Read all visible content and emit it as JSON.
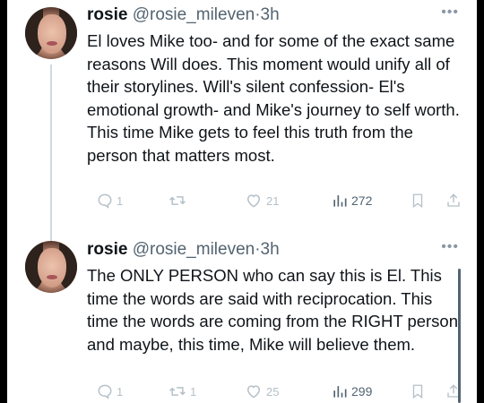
{
  "tweets": [
    {
      "name": "rosie",
      "handle": "@rosie_mileven",
      "dot": "·",
      "time": "3h",
      "text": "El loves Mike too- and for some of the exact same reasons Will does. This moment would unify all of their storylines. Will's silent confession- El's emotional growth- and Mike's journey to self worth. This time Mike gets to feel this truth from the person that matters most.",
      "replies": "1",
      "retweets": "",
      "likes": "21",
      "views": "272"
    },
    {
      "name": "rosie",
      "handle": "@rosie_mileven",
      "dot": "·",
      "time": "3h",
      "text": "The ONLY PERSON who can say this is El. This time the words are said with reciprocation. This time the words are coming from the RIGHT person and maybe, this time, Mike will believe them.",
      "replies": "1",
      "retweets": "1",
      "likes": "25",
      "views": "299"
    }
  ],
  "icons": {
    "more": "more-icon",
    "reply": "reply-icon",
    "retweet": "retweet-icon",
    "like": "heart-icon",
    "views": "bar-chart-icon",
    "bookmark": "bookmark-icon",
    "share": "share-icon"
  },
  "more_glyph": "•••",
  "colors": {
    "text": "#0f1419",
    "secondary": "#536471",
    "faded": "#b5c0c8",
    "thread_line": "#cfd9de"
  }
}
